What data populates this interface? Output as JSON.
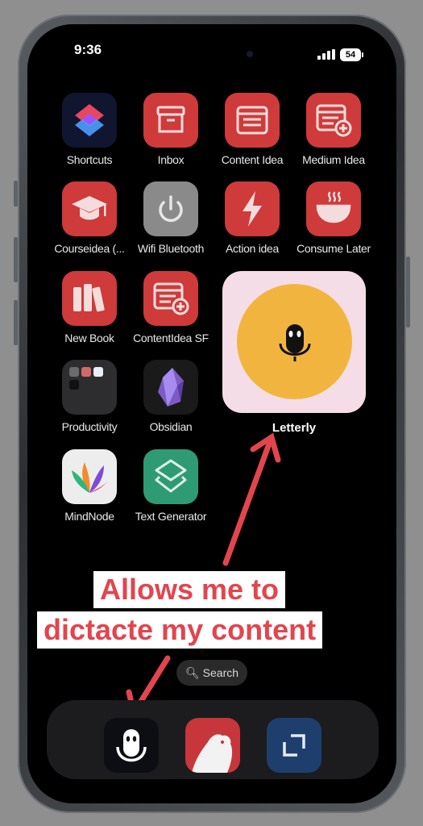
{
  "status_bar": {
    "time": "9:36",
    "battery": "54"
  },
  "apps": [
    {
      "label": "Shortcuts"
    },
    {
      "label": "Inbox"
    },
    {
      "label": "Content Idea"
    },
    {
      "label": "Medium Idea"
    },
    {
      "label": "Courseidea (..."
    },
    {
      "label": "Wifi Bluetooth"
    },
    {
      "label": "Action idea"
    },
    {
      "label": "Consume Later"
    },
    {
      "label": "New Book"
    },
    {
      "label": "ContentIdea SF"
    },
    {
      "label": "Productivity"
    },
    {
      "label": "Obsidian"
    },
    {
      "label": "MindNode"
    },
    {
      "label": "Text Generator"
    }
  ],
  "widget": {
    "label": "Letterly"
  },
  "annotation": {
    "line1": "Allows me to",
    "line2": "dictacte my content"
  },
  "search": {
    "label": "Search"
  },
  "dock": [
    {
      "name": "Letterly"
    },
    {
      "name": "Bear"
    },
    {
      "name": "Screenshot"
    }
  ],
  "colors": {
    "annotation_red": "#e2454e",
    "shortcut_red": "#cf3a3a",
    "letterly_yellow": "#f1b53f",
    "widget_pink": "#f4dde6"
  }
}
